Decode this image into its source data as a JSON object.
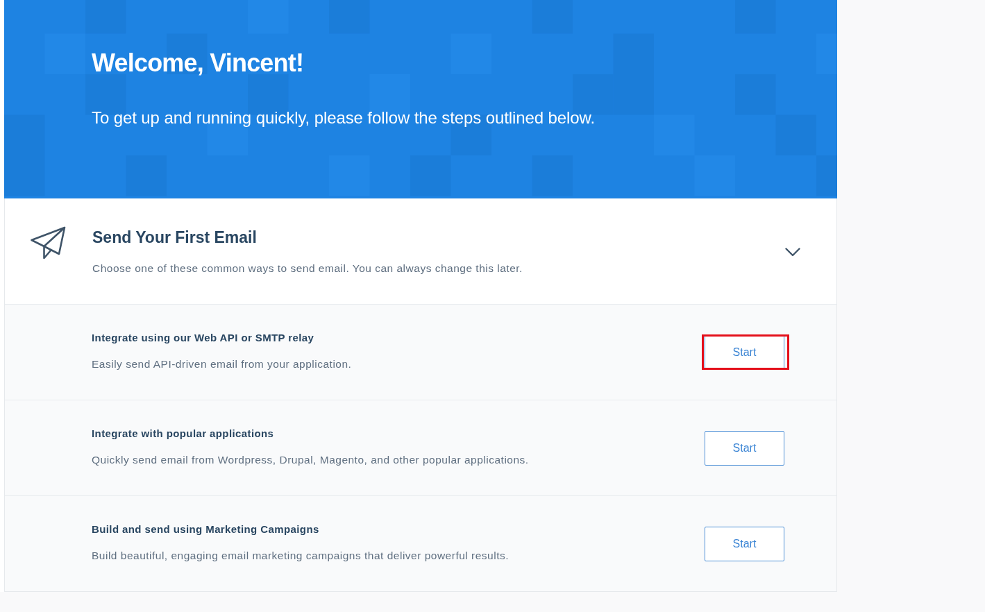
{
  "banner": {
    "title": "Welcome, Vincent!",
    "subtitle": "To get up and running quickly, please follow the steps outlined below."
  },
  "section": {
    "title": "Send Your First Email",
    "description": "Choose one of these common ways to send email. You can always change this later.",
    "expanded": true,
    "options": [
      {
        "title": "Integrate using our Web API or SMTP relay",
        "description": "Easily send API-driven email from your application.",
        "button": "Start",
        "highlighted": true
      },
      {
        "title": "Integrate with popular applications",
        "description": "Quickly send email from Wordpress, Drupal, Magento, and other popular applications.",
        "button": "Start",
        "highlighted": false
      },
      {
        "title": "Build and send using Marketing Campaigns",
        "description": "Build beautiful, engaging email marketing campaigns that deliver powerful results.",
        "button": "Start",
        "highlighted": false
      }
    ]
  }
}
